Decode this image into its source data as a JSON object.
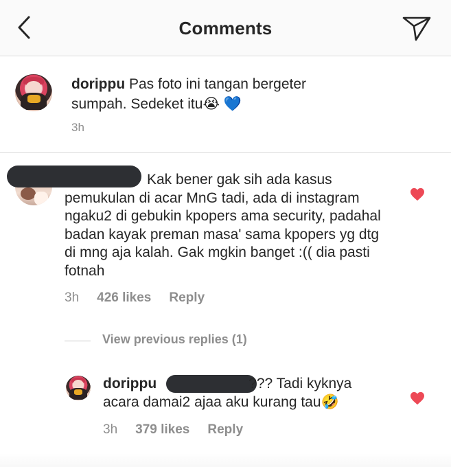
{
  "header": {
    "title": "Comments",
    "back_icon": "chevron-left-icon",
    "share_icon": "paper-plane-icon"
  },
  "caption": {
    "username": "dorippu",
    "text": "Pas foto ini tangan bergeter sumpah. Sedeket itu😭 💙",
    "time": "3h"
  },
  "comment": {
    "username": "[redacted]",
    "text": "Kak bener gak sih ada kasus pemukulan di acar MnG tadi, ada di instagram ngaku2 di gebukin kpopers ama security, padahal badan kayak preman masa' sama kpopers yg dtg di mng aja kalah. Gak mgkin banget :(( dia pasti fotnah",
    "time": "3h",
    "likes": "426 likes",
    "reply_label": "Reply",
    "liked": true
  },
  "view_previous": {
    "label": "View previous replies (1)"
  },
  "reply": {
    "username": "dorippu",
    "mention": "[redacted]",
    "text": "??? Tadi kyknya acara damai2 ajaa aku kurang tau🤣",
    "time": "3h",
    "likes": "379 likes",
    "reply_label": "Reply",
    "liked": true
  },
  "colors": {
    "heart": "#ed4956",
    "secondary_text": "#8e8e8e",
    "primary_text": "#262626",
    "divider": "#dbdbdb",
    "redaction": "#2d2f33"
  }
}
